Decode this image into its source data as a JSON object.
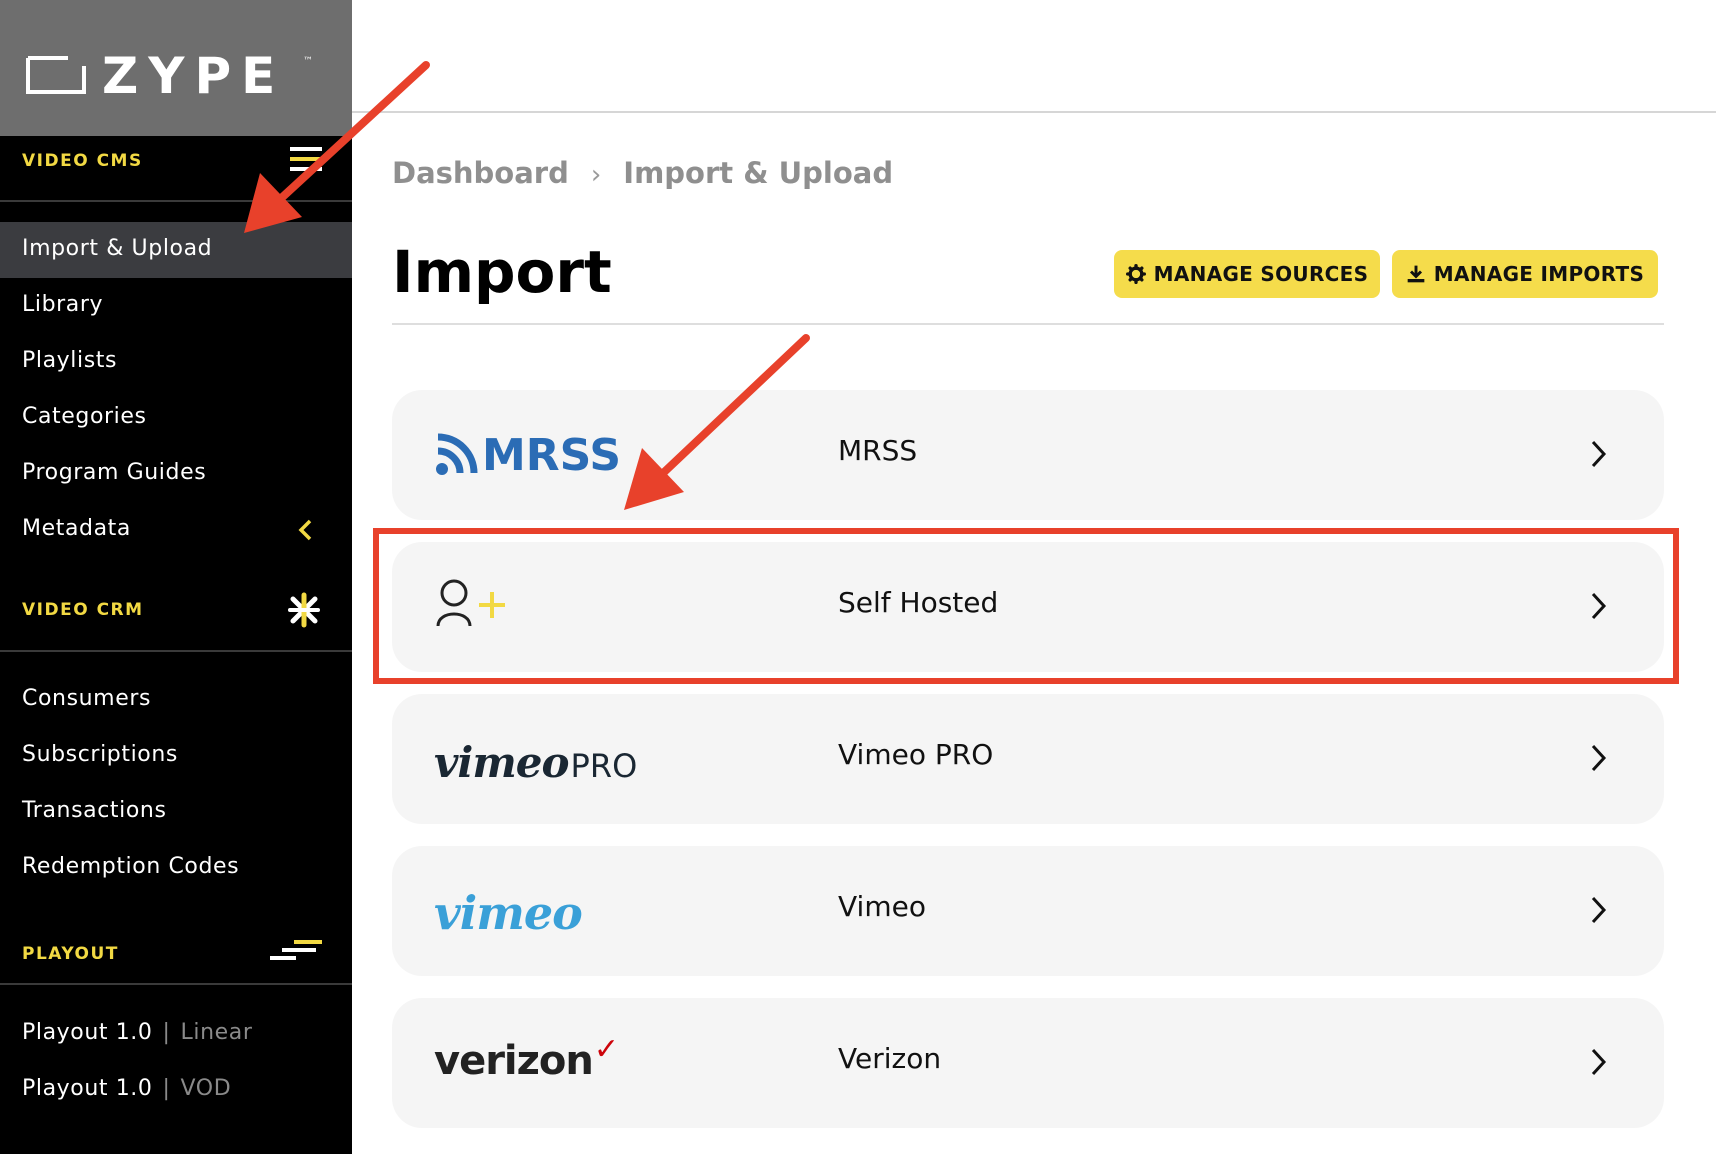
{
  "brand": {
    "name": "ZYPE",
    "trademark": "™"
  },
  "sidebar": {
    "sections": [
      {
        "title": "VIDEO CMS",
        "icon": "menu-icon"
      },
      {
        "title": "VIDEO CRM",
        "icon": "sparkle-icon"
      },
      {
        "title": "PLAYOUT",
        "icon": "lines-icon"
      }
    ],
    "cms_items": [
      {
        "label": "Import & Upload",
        "active": true
      },
      {
        "label": "Library"
      },
      {
        "label": "Playlists"
      },
      {
        "label": "Categories"
      },
      {
        "label": "Program Guides"
      },
      {
        "label": "Metadata",
        "icon": "chevron-left-icon"
      }
    ],
    "crm_items": [
      {
        "label": "Consumers"
      },
      {
        "label": "Subscriptions"
      },
      {
        "label": "Transactions"
      },
      {
        "label": "Redemption Codes"
      }
    ],
    "playout_items": [
      {
        "label": "Playout 1.0",
        "separator": "|",
        "sub": "Linear"
      },
      {
        "label": "Playout 1.0",
        "separator": "|",
        "sub": "VOD"
      }
    ]
  },
  "breadcrumb": [
    "Dashboard",
    "Import & Upload"
  ],
  "breadcrumb_separator": "›",
  "page": {
    "title": "Import",
    "buttons": [
      {
        "label": "MANAGE SOURCES",
        "icon": "gear-icon"
      },
      {
        "label": "MANAGE IMPORTS",
        "icon": "download-icon"
      }
    ]
  },
  "sources": [
    {
      "name": "MRSS",
      "logo_text": "MRSS",
      "icon": "rss-icon"
    },
    {
      "name": "Self Hosted",
      "icon": "user-add-icon",
      "highlighted": true
    },
    {
      "name": "Vimeo PRO",
      "logo_text": "vimeo",
      "logo_suffix": "PRO"
    },
    {
      "name": "Vimeo",
      "logo_text": "vimeo"
    },
    {
      "name": "Verizon",
      "logo_text": "verizon",
      "logo_check": "✓"
    }
  ],
  "colors": {
    "accent": "#f2d943",
    "sidebar_bg": "#000000",
    "logo_bg": "#6e6e6e",
    "active_bg": "#3b3c40",
    "button_bg": "#f5dc4b",
    "annotation_red": "#e8412b",
    "mrss_blue": "#2b6cb5",
    "vimeo_blue": "#3aa0d8",
    "verizon_red": "#cd040b"
  }
}
